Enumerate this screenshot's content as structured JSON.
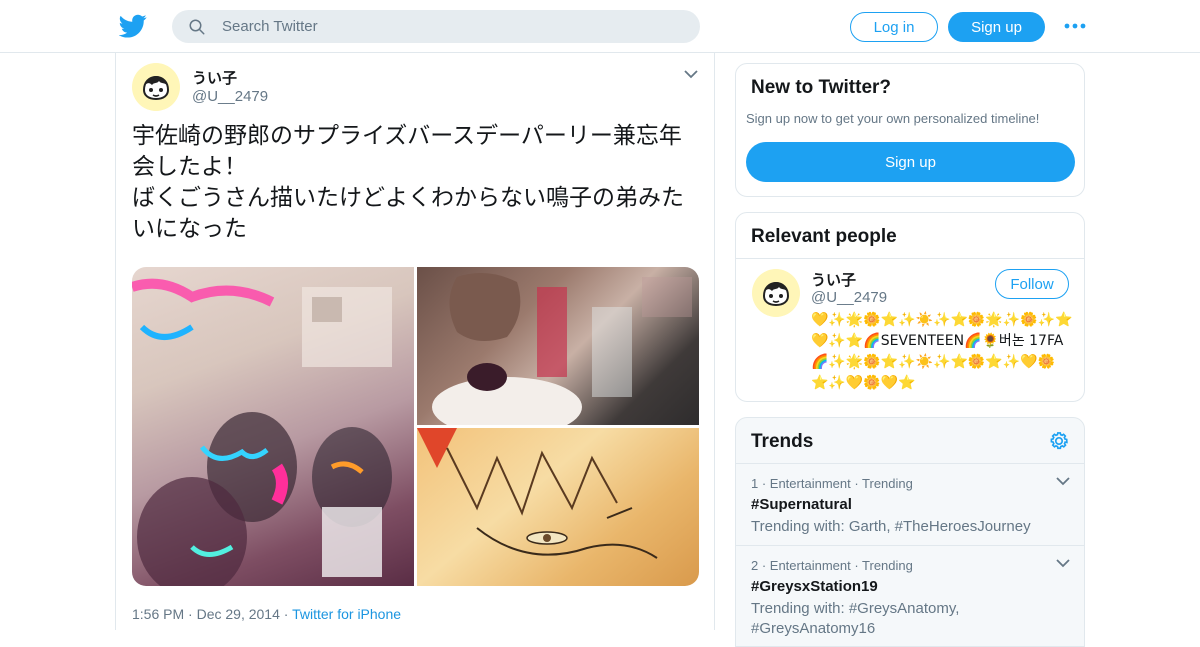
{
  "header": {
    "search_placeholder": "Search Twitter",
    "login_label": "Log in",
    "signup_label": "Sign up"
  },
  "tweet": {
    "name": "うい子",
    "handle": "@U__2479",
    "text": "宇佐崎の野郎のサプライズバースデーパーリー兼忘年会したよ！\nばくごうさん描いたけどよくわからない鳴子の弟みたいになった",
    "time": "1:56 PM",
    "date": "Dec 29, 2014",
    "source": "Twitter for iPhone"
  },
  "sidebar": {
    "new_to_twitter": {
      "title": "New to Twitter?",
      "subtitle": "Sign up now to get your own personalized timeline!",
      "button": "Sign up"
    },
    "relevant_people": {
      "title": "Relevant people",
      "person": {
        "name": "うい子",
        "handle": "@U__2479",
        "follow_label": "Follow",
        "bio": "💛✨🌟🌼⭐✨☀️✨⭐🌼🌟✨🌼✨⭐💛✨⭐🌈SEVENTEEN🌈🌻버논 17FA 🌈✨🌟🌼⭐✨☀️✨⭐🌼⭐✨💛🌼⭐✨💛🌼💛⭐"
      }
    },
    "trends": {
      "title": "Trends",
      "items": [
        {
          "meta": "1 · Entertainment · Trending",
          "name": "#Supernatural",
          "with": "Trending with: Garth, #TheHeroesJourney"
        },
        {
          "meta": "2 · Entertainment · Trending",
          "name": "#GreysxStation19",
          "with": "Trending with: #GreysAnatomy, #GreysAnatomy16"
        }
      ]
    }
  },
  "colors": {
    "brand": "#1da1f2",
    "link": "#1b95e0",
    "secondary_text": "#657786",
    "border": "#e1e8ed"
  },
  "icons": {
    "logo": "twitter-bird-icon",
    "search": "search-icon",
    "more": "more-dots-icon",
    "caret": "chevron-down-icon",
    "settings": "gear-icon"
  }
}
